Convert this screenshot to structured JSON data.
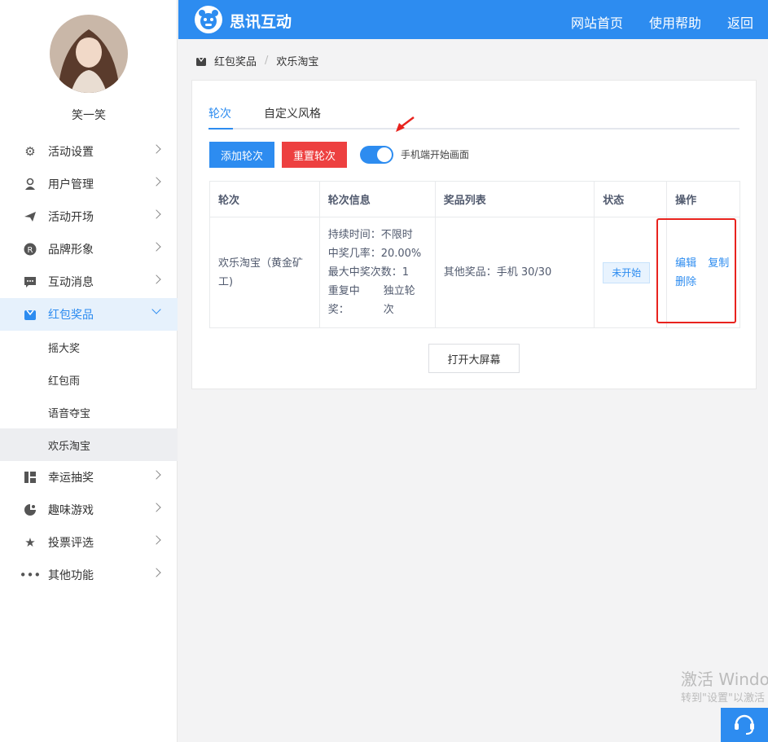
{
  "sidebar": {
    "username": "笑一笑",
    "menu": [
      {
        "label": "活动设置",
        "icon": "gears-icon"
      },
      {
        "label": "用户管理",
        "icon": "user-icon"
      },
      {
        "label": "活动开场",
        "icon": "paper-plane-icon"
      },
      {
        "label": "品牌形象",
        "icon": "registered-icon"
      },
      {
        "label": "互动消息",
        "icon": "message-icon"
      },
      {
        "label": "红包奖品",
        "icon": "gift-box-icon"
      },
      {
        "label": "幸运抽奖",
        "icon": "lottery-icon"
      },
      {
        "label": "趣味游戏",
        "icon": "game-icon"
      },
      {
        "label": "投票评选",
        "icon": "star-icon"
      },
      {
        "label": "其他功能",
        "icon": "more-icon"
      }
    ],
    "submenu": [
      "摇大奖",
      "红包雨",
      "语音夺宝",
      "欢乐淘宝"
    ]
  },
  "header": {
    "logo_text": "思讯互动",
    "nav": [
      "网站首页",
      "使用帮助",
      "返回"
    ],
    "accent": "#2d8cf0"
  },
  "breadcrumb": [
    "红包奖品",
    "欢乐淘宝"
  ],
  "tabs": [
    "轮次",
    "自定义风格"
  ],
  "toolbar": {
    "add_label": "添加轮次",
    "reset_label": "重置轮次",
    "switch_label": "手机端开始画面",
    "switch_on": true
  },
  "table": {
    "headers": [
      "轮次",
      "轮次信息",
      "奖品列表",
      "状态",
      "操作"
    ],
    "row": {
      "name": "欢乐淘宝（黄金矿工)",
      "info": {
        "duration": "持续时间：不限时",
        "rate": "中奖几率：20.00%",
        "max_wins": "最大中奖次数：1",
        "repeat_label": "重复中奖：",
        "repeat_value": "独立轮次"
      },
      "prizes": "其他奖品：手机 30/30",
      "status": "未开始",
      "actions": [
        "编辑",
        "复制",
        "删除"
      ]
    }
  },
  "open_screen_label": "打开大屏幕",
  "watermark": {
    "line1": "激活 Windo",
    "line2": "转到\"设置\"以激活"
  }
}
